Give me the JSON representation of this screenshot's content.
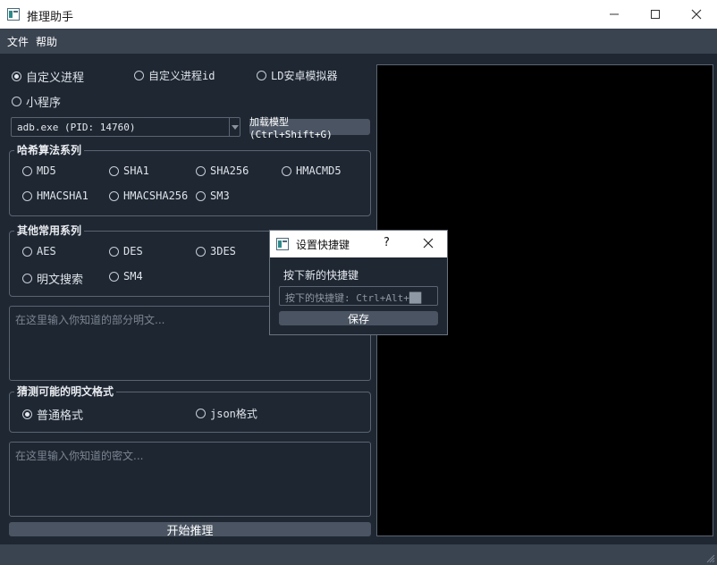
{
  "window": {
    "title": "推理助手"
  },
  "menu": [
    "文件",
    "帮助"
  ],
  "process_options": [
    {
      "label": "自定义进程",
      "checked": true
    },
    {
      "label": "自定义进程id",
      "checked": false
    },
    {
      "label": "LD安卓模拟器",
      "checked": false
    },
    {
      "label": "小程序",
      "checked": false
    }
  ],
  "process_select": {
    "value": "adb.exe (PID: 14760)"
  },
  "load_model_button": "加载模型(Ctrl+Shift+G)",
  "hash_group": {
    "title": "哈希算法系列",
    "options": [
      "MD5",
      "SHA1",
      "SHA256",
      "HMACMD5",
      "HMACSHA1",
      "HMACSHA256",
      "SM3"
    ]
  },
  "other_group": {
    "title": "其他常用系列",
    "options": [
      "AES",
      "DES",
      "3DES",
      "明文搜索",
      "SM4"
    ]
  },
  "plaintext_input": {
    "placeholder": "在这里输入你知道的部分明文..."
  },
  "format_group": {
    "title": "猜测可能的明文格式",
    "options": [
      {
        "label": "普通格式",
        "checked": true
      },
      {
        "label": "json格式",
        "checked": false
      }
    ]
  },
  "ciphertext_input": {
    "placeholder": "在这里输入你知道的密文..."
  },
  "start_button": "开始推理",
  "dialog": {
    "title": "设置快捷键",
    "help": "?",
    "prompt": "按下新的快捷键",
    "field_value": "按下的快捷键: Ctrl+Alt+██",
    "save_button": "保存"
  },
  "colors": {
    "background": "#1f2733",
    "menubar": "#3a4350",
    "button": "#4a5462",
    "output": "#000000"
  }
}
